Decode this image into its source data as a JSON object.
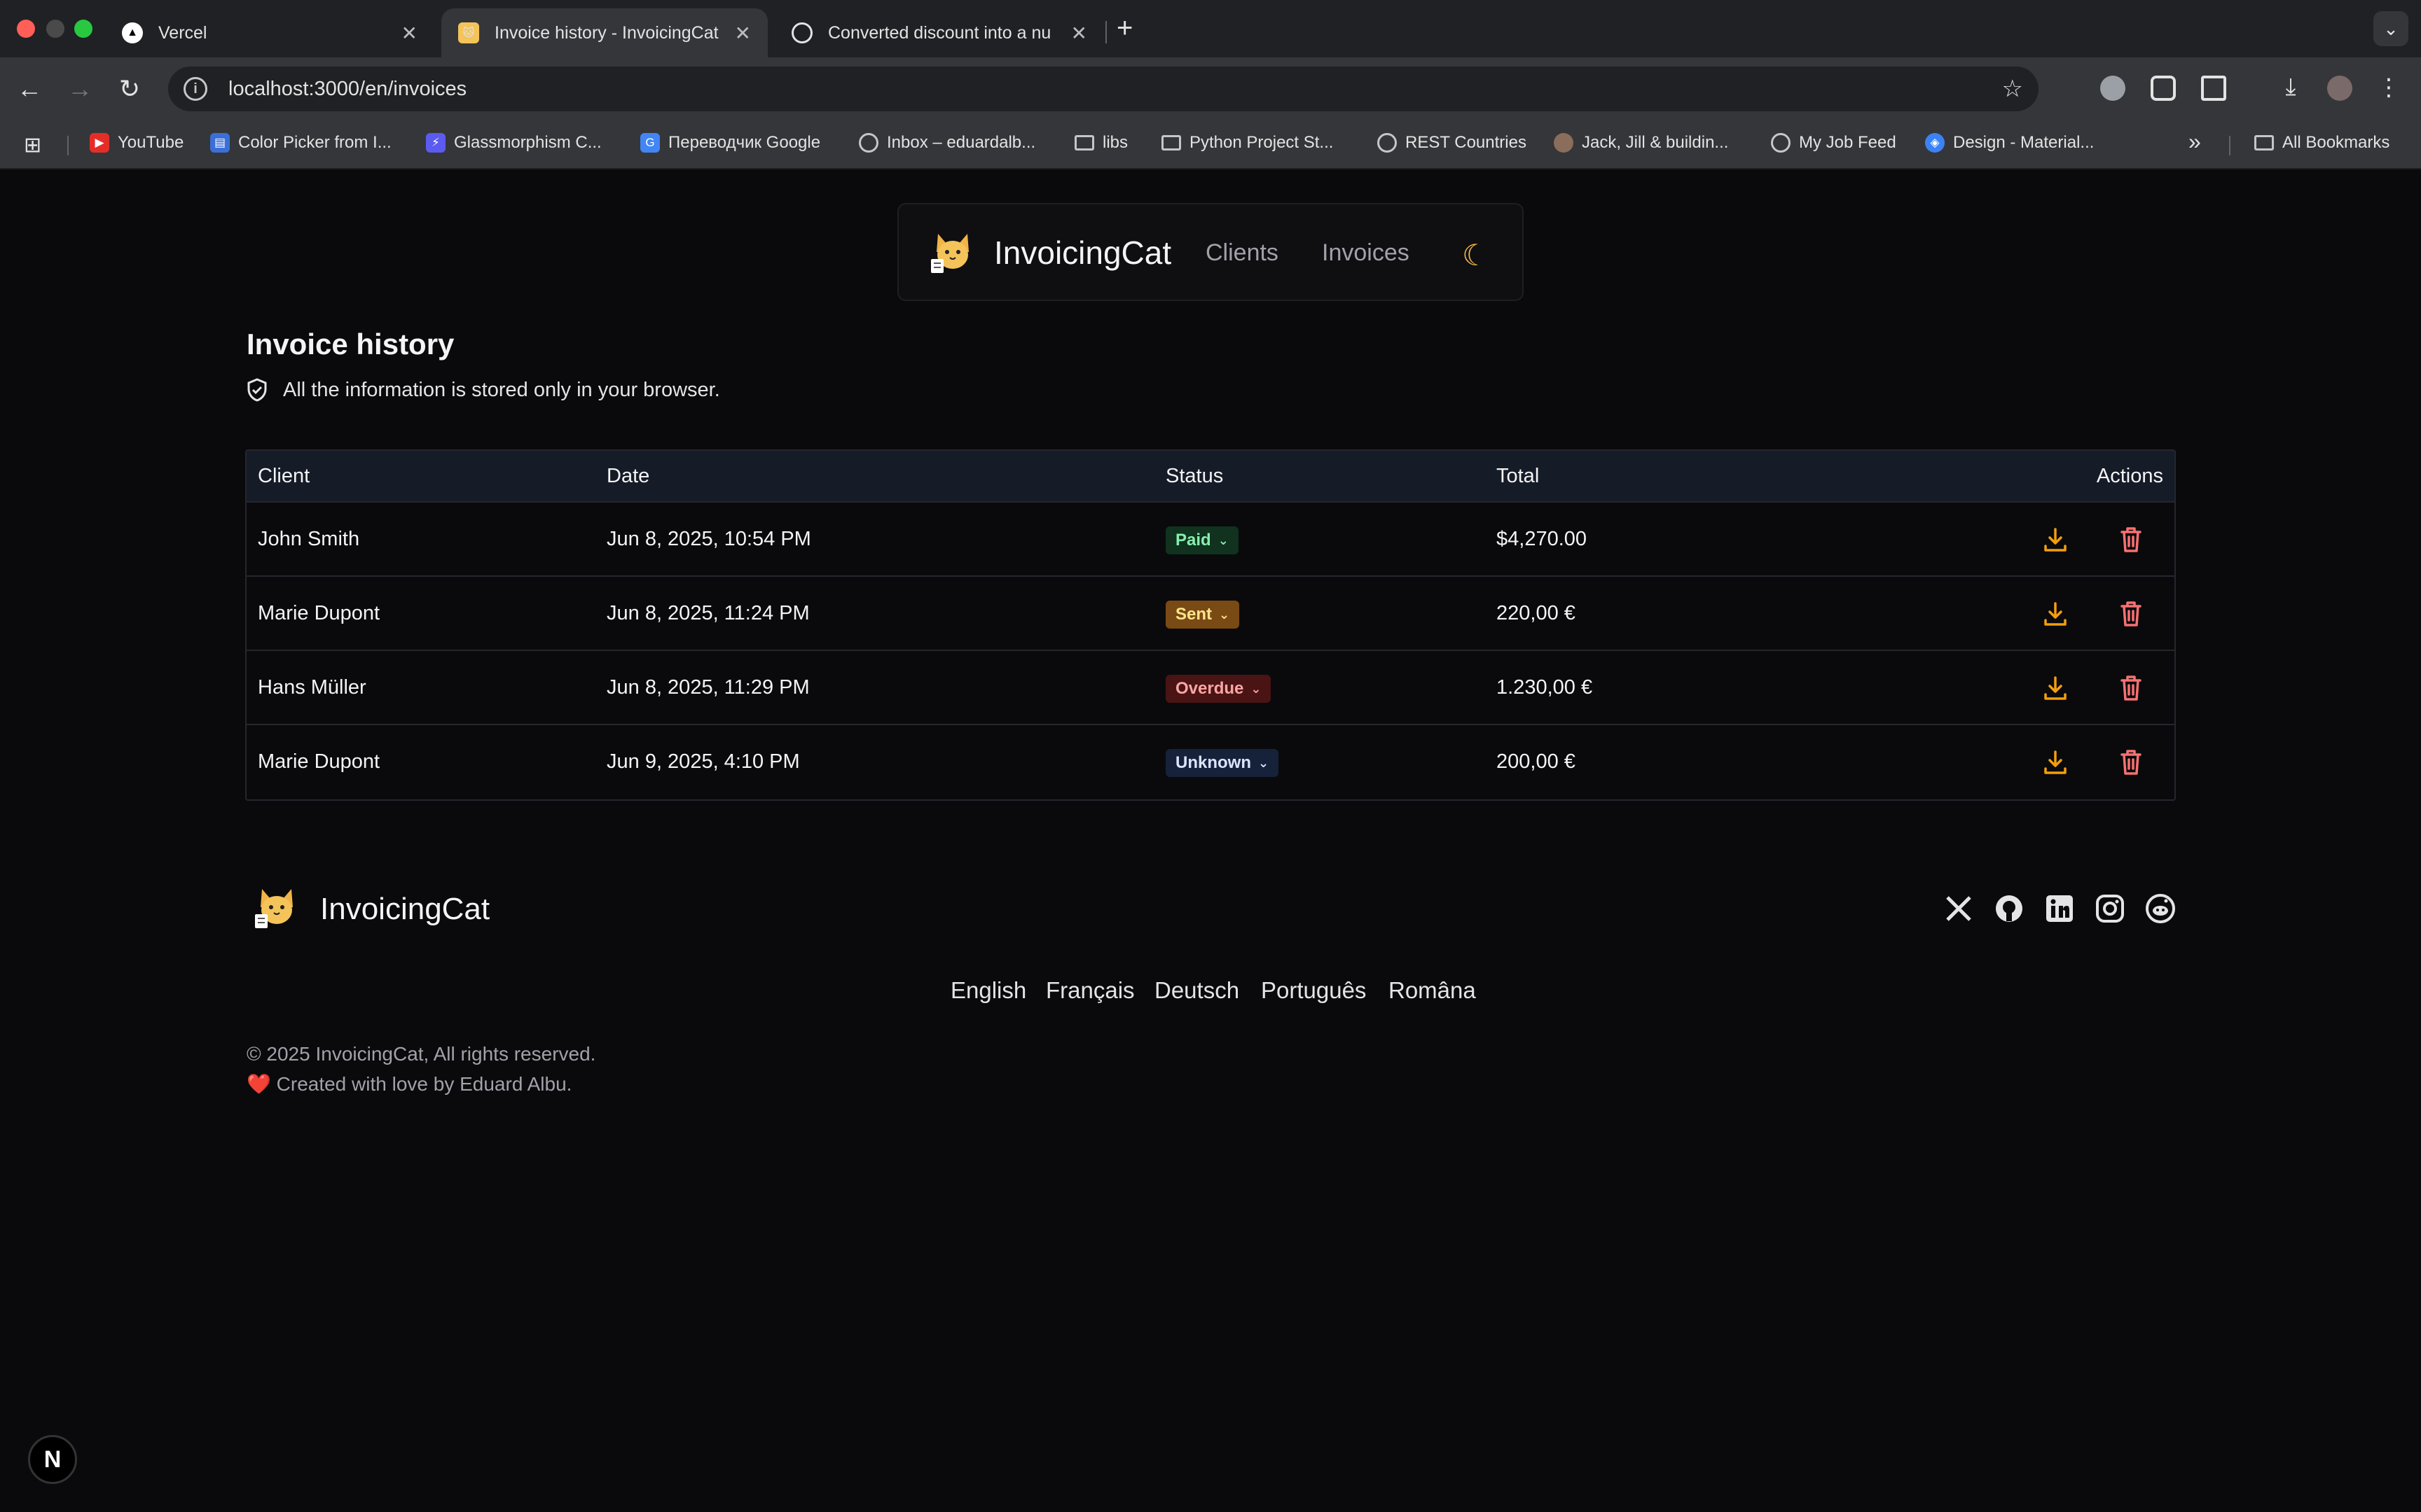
{
  "browser": {
    "tabs": [
      {
        "title": "Vercel"
      },
      {
        "title": "Invoice history - InvoicingCat"
      },
      {
        "title": "Converted discount into a nu"
      }
    ],
    "new_tab": "+",
    "url": "localhost:3000/en/invoices",
    "bookmarks": [
      {
        "label": "YouTube"
      },
      {
        "label": "Color Picker from I..."
      },
      {
        "label": "Glassmorphism C..."
      },
      {
        "label": "Переводчик Google"
      },
      {
        "label": "Inbox – eduardalb..."
      },
      {
        "label": "libs"
      },
      {
        "label": "Python Project St..."
      },
      {
        "label": "REST Countries"
      },
      {
        "label": "Jack, Jill & buildin..."
      },
      {
        "label": "My Job Feed"
      },
      {
        "label": "Design - Material..."
      }
    ],
    "all_bookmarks": "All Bookmarks",
    "more_bookmarks": "»"
  },
  "header": {
    "brand": "InvoicingCat",
    "nav": {
      "clients": "Clients",
      "invoices": "Invoices"
    }
  },
  "page": {
    "title": "Invoice history",
    "notice": "All the information is stored only in your browser."
  },
  "table": {
    "columns": {
      "client": "Client",
      "date": "Date",
      "status": "Status",
      "total": "Total",
      "actions": "Actions"
    },
    "rows": [
      {
        "client": "John Smith",
        "date": "Jun 8, 2025, 10:54 PM",
        "status": "Paid",
        "total": "$4,270.00"
      },
      {
        "client": "Marie Dupont",
        "date": "Jun 8, 2025, 11:24 PM",
        "status": "Sent",
        "total": "220,00 €"
      },
      {
        "client": "Hans Müller",
        "date": "Jun 8, 2025, 11:29 PM",
        "status": "Overdue",
        "total": "1.230,00 €"
      },
      {
        "client": "Marie Dupont",
        "date": "Jun 9, 2025, 4:10 PM",
        "status": "Unknown",
        "total": "200,00 €"
      }
    ]
  },
  "status_colors": {
    "Paid": {
      "bg": "#10321f",
      "fg": "#86efac"
    },
    "Sent": {
      "bg": "#7a4a14",
      "fg": "#fde68a"
    },
    "Overdue": {
      "bg": "#4a1414",
      "fg": "#fca5a5"
    },
    "Unknown": {
      "bg": "#16213a",
      "fg": "#dbe4ff"
    }
  },
  "accent_colors": {
    "download": "#f59e0b",
    "delete": "#f87171",
    "moon": "#f5b84a"
  },
  "footer": {
    "brand": "InvoicingCat",
    "languages": [
      "English",
      "Français",
      "Deutsch",
      "Português",
      "Româna"
    ],
    "copyright": "© 2025 InvoicingCat, All rights reserved.",
    "credit": "❤️ Created with love by Eduard Albu.",
    "social_icons": [
      "x-icon",
      "github-icon",
      "linkedin-icon",
      "instagram-icon",
      "reddit-icon"
    ]
  },
  "dev_badge": "N"
}
